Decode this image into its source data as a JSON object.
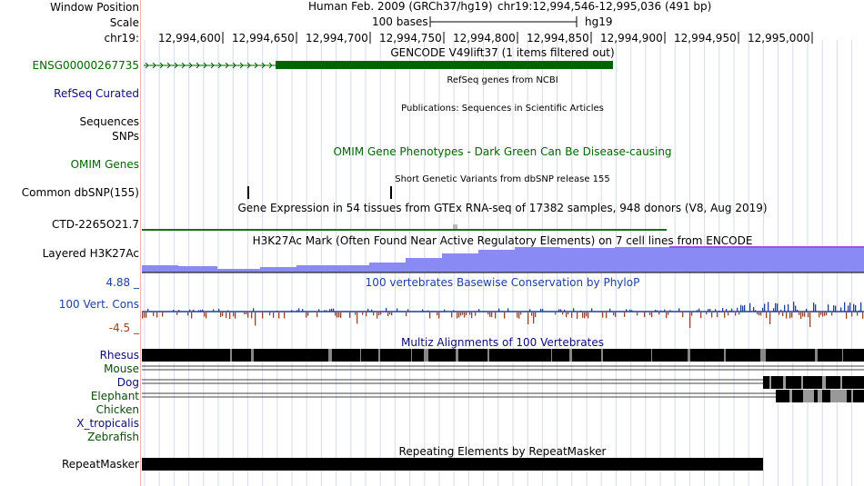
{
  "header": {
    "window_position_label": "Window Position",
    "scale_label": "Scale",
    "chrom_label": "chr19:",
    "assembly_text": "Human Feb. 2009 (GRCh37/hg19)",
    "position_text": "chr19:12,994,546-12,995,036 (491 bp)",
    "scale_bar_text": "100 bases",
    "scale_db": "hg19",
    "ruler_ticks": [
      "12,994,600",
      "12,994,650",
      "12,994,700",
      "12,994,750",
      "12,994,800",
      "12,994,850",
      "12,994,900",
      "12,994,950",
      "12,995,000"
    ]
  },
  "tracks": {
    "gencode": {
      "label": "ENSG00000267735",
      "title": "GENCODE V49lift37 (1 items filtered out)",
      "label_color": "#006400",
      "feature_color": "#006400"
    },
    "refseq": {
      "label": "RefSeq Curated",
      "title": "RefSeq genes from NCBI",
      "label_color": "#0c0c78"
    },
    "publications": {
      "label": "Sequences",
      "title": "Publications: Sequences in Scientific Articles"
    },
    "snps_label": "SNPs",
    "omim": {
      "label": "OMIM Genes",
      "title": "OMIM Gene Phenotypes - Dark Green Can Be Disease-causing",
      "label_color": "#006400"
    },
    "dbsnp": {
      "label": "Common dbSNP(155)",
      "title": "Short Genetic Variants from dbSNP release 155"
    },
    "gtex": {
      "label": "CTD-2265O21.7",
      "title": "Gene Expression in 54 tissues from GTEx RNA-seq of 17382 samples, 948 donors (V8, Aug 2019)"
    },
    "h3k27ac": {
      "label": "Layered H3K27Ac",
      "title": "H3K27Ac Mark (Often Found Near Active Regulatory Elements) on 7 cell lines from ENCODE",
      "color": "#8080f0"
    },
    "phylop": {
      "label": "100 Vert. Cons",
      "title": "100 vertebrates Basewise Conservation by PhyloP",
      "max_label": "4.88 _",
      "min_label": "-4.5 _",
      "label_color": "#1f3f9f",
      "pos_color": "#1f3f9f",
      "neg_color": "#9f3f1f"
    },
    "multiz": {
      "title": "Multiz Alignments of 100 Vertebrates",
      "species": [
        "Rhesus",
        "Mouse",
        "Dog",
        "Elephant",
        "Chicken",
        "X_tropicalis",
        "Zebrafish"
      ],
      "label_color": "#0c4a0c"
    },
    "repeatmasker": {
      "label": "RepeatMasker",
      "title": "Repeating Elements by RepeatMasker"
    }
  },
  "colors": {
    "grid": "#cfd8e8",
    "divider": "#f4b0b0"
  }
}
